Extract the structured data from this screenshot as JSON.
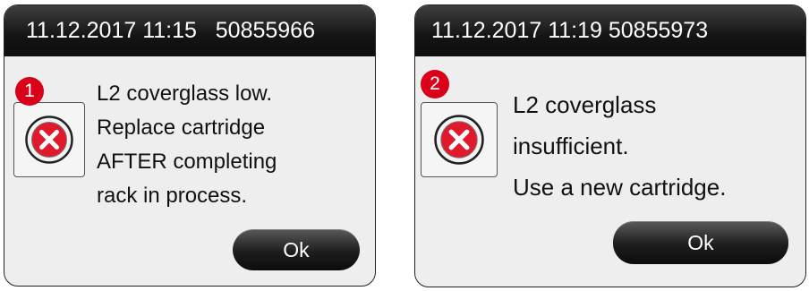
{
  "dialogs": [
    {
      "header": "11.12.2017 11:15   50855966",
      "callout": "1",
      "icon": "error-x-icon",
      "message_lines": [
        "L2 coverglass low.",
        "Replace cartridge",
        "AFTER completing",
        "rack in process."
      ],
      "ok_label": "Ok"
    },
    {
      "header": "11.12.2017 11:19 50855973",
      "callout": "2",
      "icon": "error-x-icon",
      "message_lines": [
        "L2 coverglass",
        "insufficient.",
        "Use a new cartridge."
      ],
      "ok_label": "Ok"
    }
  ],
  "colors": {
    "error_red": "#e0192b",
    "callout_red": "#d9001a",
    "header_black": "#141414"
  }
}
